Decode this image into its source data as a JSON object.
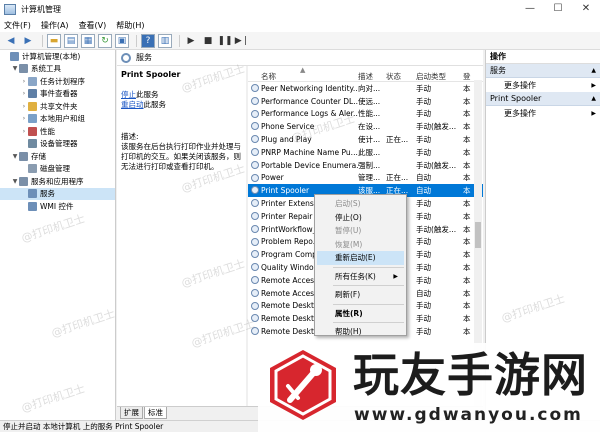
{
  "window": {
    "title": "计算机管理",
    "min": "—",
    "max": "☐",
    "close": "✕"
  },
  "menu": [
    "文件(F)",
    "操作(A)",
    "查看(V)",
    "帮助(H)"
  ],
  "tree": [
    {
      "label": "计算机管理(本地)",
      "level": 0,
      "caret": "",
      "icon": "#6d8fb8"
    },
    {
      "label": "系统工具",
      "level": 1,
      "caret": "▼",
      "icon": "#7a8fa8"
    },
    {
      "label": "任务计划程序",
      "level": 2,
      "caret": "›",
      "icon": "#8aa6c7"
    },
    {
      "label": "事件查看器",
      "level": 2,
      "caret": "›",
      "icon": "#5f7fa6"
    },
    {
      "label": "共享文件夹",
      "level": 2,
      "caret": "›",
      "icon": "#e0b040"
    },
    {
      "label": "本地用户和组",
      "level": 2,
      "caret": "›",
      "icon": "#7aa0c8"
    },
    {
      "label": "性能",
      "level": 2,
      "caret": "›",
      "icon": "#c05050"
    },
    {
      "label": "设备管理器",
      "level": 2,
      "caret": "",
      "icon": "#6f8aa0"
    },
    {
      "label": "存储",
      "level": 1,
      "caret": "▼",
      "icon": "#7a8fa8"
    },
    {
      "label": "磁盘管理",
      "level": 2,
      "caret": "",
      "icon": "#8a9cb0"
    },
    {
      "label": "服务和应用程序",
      "level": 1,
      "caret": "▼",
      "icon": "#7a8fa8"
    },
    {
      "label": "服务",
      "level": 2,
      "caret": "",
      "icon": "#6d8fb8",
      "selected": true
    },
    {
      "label": "WMI 控件",
      "level": 2,
      "caret": "",
      "icon": "#6d8fb8"
    }
  ],
  "center": {
    "header": "服务",
    "service_title": "Print Spooler",
    "stop_link": "停止",
    "stop_suffix": "此服务",
    "restart_link": "重启动",
    "restart_suffix": "此服务",
    "desc_label": "描述:",
    "desc_text": "该服务在后台执行打印作业并处理与打印机的交互。如果关闭该服务，则无法进行打印或查看打印机。"
  },
  "columns": {
    "name": "名称",
    "desc": "描述",
    "status": "状态",
    "type": "启动类型",
    "logon": "登"
  },
  "rows": [
    {
      "name": "Peer Networking Identity...",
      "desc": "向对...",
      "status": "",
      "type": "手动",
      "logon": "本"
    },
    {
      "name": "Performance Counter DL...",
      "desc": "使远...",
      "status": "",
      "type": "手动",
      "logon": "本"
    },
    {
      "name": "Performance Logs & Aler...",
      "desc": "性能...",
      "status": "",
      "type": "手动",
      "logon": "本"
    },
    {
      "name": "Phone Service",
      "desc": "在设...",
      "status": "",
      "type": "手动(触发...",
      "logon": "本"
    },
    {
      "name": "Plug and Play",
      "desc": "使计...",
      "status": "正在...",
      "type": "手动",
      "logon": "本"
    },
    {
      "name": "PNRP Machine Name Pu...",
      "desc": "此服...",
      "status": "",
      "type": "手动",
      "logon": "本"
    },
    {
      "name": "Portable Device Enumera...",
      "desc": "强制...",
      "status": "",
      "type": "手动(触发...",
      "logon": "本"
    },
    {
      "name": "Power",
      "desc": "管理...",
      "status": "正在...",
      "type": "自动",
      "logon": "本"
    },
    {
      "name": "Print Spooler",
      "desc": "该服...",
      "status": "正在...",
      "type": "自动",
      "logon": "本",
      "selected": true
    },
    {
      "name": "Printer Extensio...",
      "desc": "",
      "status": "",
      "type": "手动",
      "logon": "本"
    },
    {
      "name": "Printer Repair ...",
      "desc": "",
      "status": "",
      "type": "手动",
      "logon": "本"
    },
    {
      "name": "PrintWorkflow_...",
      "desc": "",
      "status": "",
      "type": "手动(触发...",
      "logon": "本"
    },
    {
      "name": "Problem Repo...",
      "desc": "",
      "status": "",
      "type": "手动",
      "logon": "本"
    },
    {
      "name": "Program Comp...",
      "desc": "",
      "status": "",
      "type": "手动",
      "logon": "本"
    },
    {
      "name": "Quality Windo...",
      "desc": "",
      "status": "",
      "type": "手动",
      "logon": "本"
    },
    {
      "name": "Remote Access...",
      "desc": "",
      "status": "",
      "type": "手动",
      "logon": "本"
    },
    {
      "name": "Remote Access...",
      "desc": "",
      "status": "",
      "type": "自动",
      "logon": "本"
    },
    {
      "name": "Remote Deskto...",
      "desc": "",
      "status": "",
      "type": "手动",
      "logon": "本"
    },
    {
      "name": "Remote Deskto...",
      "desc": "",
      "status": "",
      "type": "手动",
      "logon": "本"
    },
    {
      "name": "Remote Deskto...",
      "desc": "",
      "status": "",
      "type": "手动",
      "logon": "本"
    }
  ],
  "actions": {
    "header": "操作",
    "section1": "服务",
    "more1": "更多操作",
    "section2": "Print Spooler",
    "more2": "更多操作"
  },
  "context_menu": [
    {
      "label": "启动(S)",
      "disabled": true
    },
    {
      "label": "停止(O)"
    },
    {
      "label": "暂停(U)",
      "disabled": true
    },
    {
      "label": "恢复(M)",
      "disabled": true
    },
    {
      "label": "重新启动(E)",
      "highlight": true
    },
    {
      "sep": true
    },
    {
      "label": "所有任务(K)",
      "submenu": true
    },
    {
      "sep": true
    },
    {
      "label": "刷新(F)"
    },
    {
      "sep": true
    },
    {
      "label": "属性(R)",
      "bold": true
    },
    {
      "sep": true
    },
    {
      "label": "帮助(H)"
    }
  ],
  "tabs": [
    "扩展",
    "标准"
  ],
  "status": "停止并启动 本地计算机 上的服务 Print Spooler",
  "watermark": "@打印机卫士",
  "brand": {
    "name": "玩友手游网",
    "url": "www.gdwanyou.com"
  },
  "colors": {
    "selection": "#0078d7",
    "link": "#1a56c4",
    "hover": "#cce4f7"
  }
}
